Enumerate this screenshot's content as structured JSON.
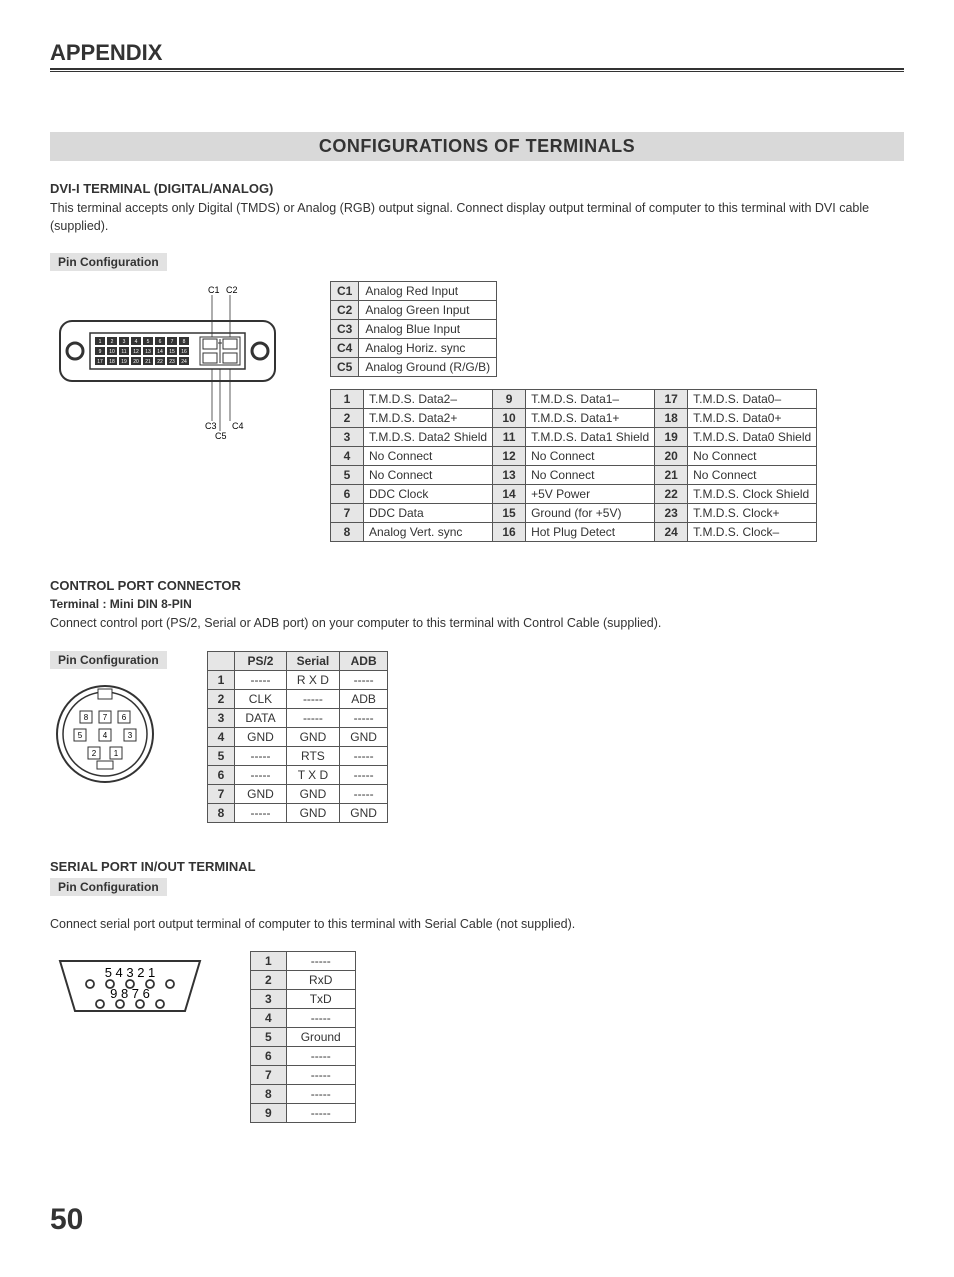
{
  "header": "APPENDIX",
  "section_title": "CONFIGURATIONS OF TERMINALS",
  "page_number": "50",
  "dvi": {
    "title": "DVI-I TERMINAL (DIGITAL/ANALOG)",
    "desc": "This terminal accepts only Digital (TMDS) or Analog (RGB) output signal. Connect display output terminal of computer to this terminal with DVI cable (supplied).",
    "pin_label": "Pin Configuration",
    "c_pins": [
      {
        "n": "C1",
        "v": "Analog Red Input"
      },
      {
        "n": "C2",
        "v": "Analog Green Input"
      },
      {
        "n": "C3",
        "v": "Analog Blue Input"
      },
      {
        "n": "C4",
        "v": "Analog Horiz. sync"
      },
      {
        "n": "C5",
        "v": "Analog Ground (R/G/B)"
      }
    ],
    "pins24": [
      {
        "n": "1",
        "v": "T.M.D.S. Data2–"
      },
      {
        "n": "9",
        "v": "T.M.D.S. Data1–"
      },
      {
        "n": "17",
        "v": "T.M.D.S. Data0–"
      },
      {
        "n": "2",
        "v": "T.M.D.S. Data2+"
      },
      {
        "n": "10",
        "v": "T.M.D.S. Data1+"
      },
      {
        "n": "18",
        "v": "T.M.D.S. Data0+"
      },
      {
        "n": "3",
        "v": "T.M.D.S. Data2 Shield"
      },
      {
        "n": "11",
        "v": "T.M.D.S. Data1 Shield"
      },
      {
        "n": "19",
        "v": "T.M.D.S. Data0 Shield"
      },
      {
        "n": "4",
        "v": "No Connect"
      },
      {
        "n": "12",
        "v": "No Connect"
      },
      {
        "n": "20",
        "v": "No Connect"
      },
      {
        "n": "5",
        "v": "No Connect"
      },
      {
        "n": "13",
        "v": "No Connect"
      },
      {
        "n": "21",
        "v": "No Connect"
      },
      {
        "n": "6",
        "v": "DDC Clock"
      },
      {
        "n": "14",
        "v": "+5V Power"
      },
      {
        "n": "22",
        "v": "T.M.D.S. Clock Shield"
      },
      {
        "n": "7",
        "v": "DDC Data"
      },
      {
        "n": "15",
        "v": "Ground (for +5V)"
      },
      {
        "n": "23",
        "v": "T.M.D.S. Clock+"
      },
      {
        "n": "8",
        "v": "Analog Vert. sync"
      },
      {
        "n": "16",
        "v": "Hot Plug Detect"
      },
      {
        "n": "24",
        "v": "T.M.D.S. Clock–"
      }
    ],
    "diag_labels": {
      "c1": "C1",
      "c2": "C2",
      "c3": "C3",
      "c4": "C4",
      "c5": "C5"
    }
  },
  "control": {
    "title": "CONTROL PORT CONNECTOR",
    "sub": "Terminal : Mini DIN 8-PIN",
    "desc": "Connect control port (PS/2, Serial or ADB port) on your computer to this terminal with Control Cable (supplied).",
    "pin_label": "Pin Configuration",
    "headers": [
      "",
      "PS/2",
      "Serial",
      "ADB"
    ],
    "rows": [
      [
        "1",
        "-----",
        "R X D",
        "-----"
      ],
      [
        "2",
        "CLK",
        "-----",
        "ADB"
      ],
      [
        "3",
        "DATA",
        "-----",
        "-----"
      ],
      [
        "4",
        "GND",
        "GND",
        "GND"
      ],
      [
        "5",
        "-----",
        "RTS",
        "-----"
      ],
      [
        "6",
        "-----",
        "T X D",
        "-----"
      ],
      [
        "7",
        "GND",
        "GND",
        "-----"
      ],
      [
        "8",
        "-----",
        "GND",
        "GND"
      ]
    ]
  },
  "serial": {
    "title": "SERIAL PORT IN/OUT TERMINAL",
    "pin_label": "Pin Configuration",
    "desc": "Connect serial port output terminal of computer to this terminal with Serial Cable (not supplied).",
    "rows": [
      [
        "1",
        "-----"
      ],
      [
        "2",
        "RxD"
      ],
      [
        "3",
        "TxD"
      ],
      [
        "4",
        "-----"
      ],
      [
        "5",
        "Ground"
      ],
      [
        "6",
        "-----"
      ],
      [
        "7",
        "-----"
      ],
      [
        "8",
        "-----"
      ],
      [
        "9",
        "-----"
      ]
    ],
    "diag_top": "5   4   3   2   1",
    "diag_bot": "9   8   7   6"
  }
}
